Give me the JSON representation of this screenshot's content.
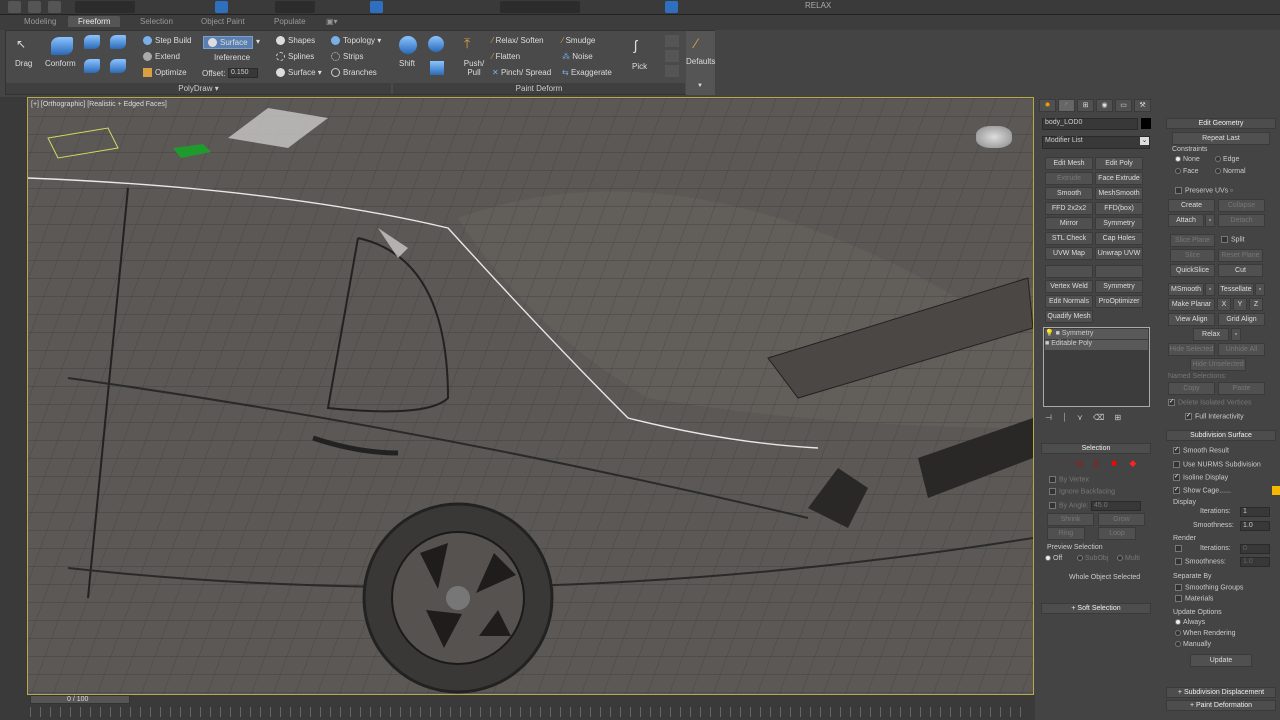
{
  "ribbon_tabs": [
    "Modeling",
    "Freeform",
    "Selection",
    "Object Paint",
    "Populate"
  ],
  "active_tab": "Freeform",
  "ribbon": {
    "drag": "Drag",
    "conform": "Conform",
    "step_build": "Step Build",
    "extend": "Extend",
    "optimize": "Optimize",
    "surface_btn": "Surface",
    "reference": "Ireference",
    "offset_label": "Offset:",
    "offset_value": "0.150",
    "shapes": "Shapes",
    "splines": "Splines",
    "surface": "Surface",
    "topology": "Topology",
    "strips": "Strips",
    "branches": "Branches",
    "shift": "Shift",
    "push_pull": "Push/ Pull",
    "relax_soften": "Relax/ Soften",
    "flatten": "Flatten",
    "pinch_spread": "Pinch/ Spread",
    "smudge": "Smudge",
    "noise": "Noise",
    "exaggerate": "Exaggerate",
    "pick": "Pick",
    "defaults": "Defaults",
    "group_polydraw": "PolyDraw ▾",
    "group_paint_deform": "Paint Deform"
  },
  "toolbar": {
    "relax_label": "RELAX"
  },
  "viewport": {
    "label": "[+] [Orthographic] [Realistic + Edged Faces]"
  },
  "modify_panel": {
    "object_name": "body_LOD0",
    "modifier_list": "Modifier List",
    "modifier_buttons": [
      [
        "Edit Mesh",
        "Edit Poly"
      ],
      [
        "Extrude",
        "Face Extrude"
      ],
      [
        "Smooth",
        "MeshSmooth"
      ],
      [
        "FFD 2x2x2",
        "FFD(box)"
      ],
      [
        "Mirror",
        "Symmetry"
      ],
      [
        "STL Check",
        "Cap Holes"
      ],
      [
        "UVW Map",
        "Unwrap UVW"
      ],
      [
        "",
        ""
      ],
      [
        "Vertex Weld",
        "Symmetry"
      ],
      [
        "Edit Normals",
        "ProOptimizer"
      ],
      [
        "Quadify Mesh",
        ""
      ]
    ],
    "stack": [
      "Symmetry",
      "Editable Poly"
    ]
  },
  "selection": {
    "title": "Selection",
    "by_vertex": "By Vertex",
    "ignore_backfacing": "Ignore Backfacing",
    "by_angle": "By Angle:",
    "angle_value": "45.0",
    "shrink": "Shrink",
    "grow": "Grow",
    "ring": "Ring",
    "loop": "Loop",
    "preview_selection": "Preview Selection",
    "preview_options": [
      "Off",
      "SubObj",
      "Multi"
    ],
    "status": "Whole Object Selected",
    "soft_selection": "Soft Selection"
  },
  "edit_geometry": {
    "title": "Edit Geometry",
    "repeat_last": "Repeat Last",
    "constraints": "Constraints",
    "constraint_options": [
      "None",
      "Edge",
      "Face",
      "Normal"
    ],
    "preserve_uvs": "Preserve UVs",
    "create": "Create",
    "collapse": "Collapse",
    "attach": "Attach",
    "detach": "Detach",
    "slice_plane": "Slice Plane",
    "split": "Split",
    "slice": "Slice",
    "reset_plane": "Reset Plane",
    "quickslice": "QuickSlice",
    "cut": "Cut",
    "msmooth": "MSmooth",
    "tessellate": "Tessellate",
    "make_planar": "Make Planar",
    "x": "X",
    "y": "Y",
    "z": "Z",
    "view_align": "View Align",
    "grid_align": "Grid Align",
    "relax": "Relax",
    "hide_selected": "Hide Selected",
    "unhide_all": "Unhide All",
    "hide_unselected": "Hide Unselected",
    "named_selections": "Named Selections:",
    "copy": "Copy",
    "paste": "Paste",
    "delete_isolated": "Delete Isolated Vertices",
    "full_interactivity": "Full Interactivity"
  },
  "subdivision": {
    "title": "Subdivision Surface",
    "smooth_result": "Smooth Result",
    "use_nurms": "Use NURMS Subdivision",
    "isoline": "Isoline Display",
    "show_cage": "Show Cage......",
    "display": "Display",
    "iterations": "Iterations:",
    "smoothness": "Smoothness:",
    "display_iterations": "1",
    "display_smoothness": "1.0",
    "render": "Render",
    "render_iterations": "0",
    "render_smoothness": "1.0",
    "separate_by": "Separate By",
    "smoothing_groups": "Smoothing Groups",
    "materials": "Materials",
    "update_options": "Update Options",
    "update_modes": [
      "Always",
      "When Rendering",
      "Manually"
    ],
    "update": "Update",
    "cage_colors": [
      "#f5b800",
      "#e0e08a"
    ]
  },
  "rollouts": [
    "Subdivision Displacement",
    "Paint Deformation"
  ],
  "timeline": {
    "frame": "0 / 100"
  }
}
